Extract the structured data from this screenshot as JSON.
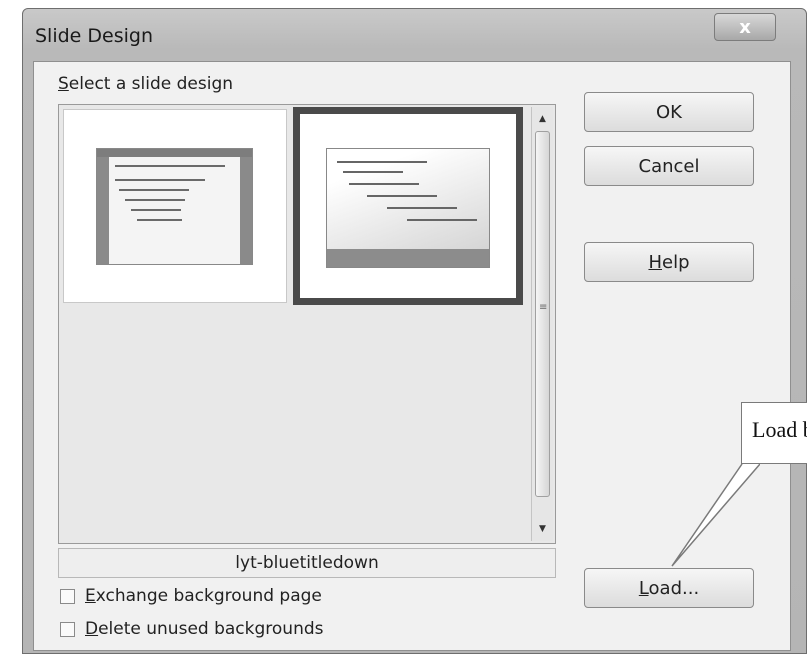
{
  "window": {
    "title": "Slide Design",
    "close_label": "x"
  },
  "gallery": {
    "section_label_accel": "S",
    "section_label_rest": "elect a slide design",
    "selected_design": "lyt-bluetitledown",
    "scroll_up_glyph": "▲",
    "scroll_down_glyph": "▼"
  },
  "checkboxes": {
    "exchange_accel": "E",
    "exchange_rest": "xchange background page",
    "exchange_checked": false,
    "delete_accel": "D",
    "delete_rest": "elete unused backgrounds",
    "delete_checked": false
  },
  "buttons": {
    "ok": "OK",
    "cancel": "Cancel",
    "help_accel": "H",
    "help_rest": "elp",
    "load_accel": "L",
    "load_rest": "oad..."
  },
  "annotation": {
    "callout_text": "Load button"
  },
  "icons": {
    "close": "close-icon",
    "scroll_up": "chevron-up-icon",
    "scroll_down": "chevron-down-icon",
    "grip": "grip-icon"
  }
}
